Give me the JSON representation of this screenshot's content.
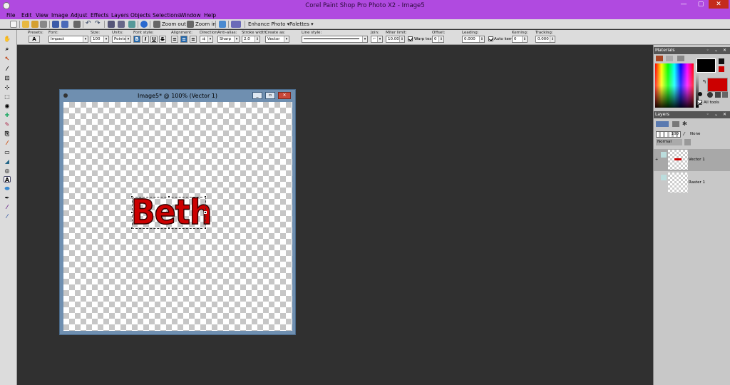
{
  "window": {
    "title": "Corel Paint Shop Pro Photo X2 - Image5",
    "controls": {
      "minimize": "—",
      "maximize": "▢",
      "close": "✕"
    }
  },
  "menu": [
    "File",
    "Edit",
    "View",
    "Image",
    "Adjust",
    "Effects",
    "Layers",
    "Objects",
    "Selections",
    "Window",
    "Help"
  ],
  "toolbar": {
    "zoom_out_label": "Zoom out",
    "zoom_in_label": "Zoom in",
    "enhance_label": "Enhance Photo ▾",
    "palettes_label": "Palettes ▾"
  },
  "tool_options": {
    "presets": {
      "label": "Presets:"
    },
    "font": {
      "label": "Font:",
      "value": "Impact"
    },
    "size": {
      "label": "Size:",
      "value": "100"
    },
    "units": {
      "label": "Units:",
      "value": "Points"
    },
    "font_style": {
      "label": "Font style:",
      "bold": "B",
      "italic": "I",
      "underline": "U",
      "strike": "S"
    },
    "alignment": {
      "label": "Alignment:"
    },
    "direction": {
      "label": "Direction:"
    },
    "antialias": {
      "label": "Anti-alias:",
      "value": "Sharp"
    },
    "stroke_width": {
      "label": "Stroke width:",
      "value": "2.0"
    },
    "create_as": {
      "label": "Create as:",
      "value": "Vector"
    },
    "line_style": {
      "label": "Line style:"
    },
    "join": {
      "label": "Join:"
    },
    "miter_limit": {
      "label": "Miter limit:",
      "value": "10.00"
    },
    "warp_text": {
      "label": "Warp text",
      "checked": true
    },
    "offset": {
      "label": "Offset:",
      "value": "0"
    },
    "leading": {
      "label": "Leading:",
      "value": "0.000"
    },
    "auto_kern": {
      "label": "Auto kern",
      "checked": true
    },
    "kerning": {
      "label": "Kerning:",
      "value": "0"
    },
    "tracking": {
      "label": "Tracking:",
      "value": "0.000"
    }
  },
  "image_window": {
    "title": "Image5* @ 100% (Vector 1)",
    "canvas_text": "Beth",
    "text_color": "#cc0000"
  },
  "materials": {
    "title": "Materials",
    "foreground_color": "#000000",
    "background_color": "#cc0000",
    "all_tools_label": "All tools",
    "all_tools_checked": true
  },
  "layers": {
    "title": "Layers",
    "opacity": "100",
    "mask_label": "None",
    "blend_mode": "Normal",
    "items": [
      {
        "name": "Vector 1",
        "selected": true
      },
      {
        "name": "Raster 1",
        "selected": false
      }
    ]
  }
}
